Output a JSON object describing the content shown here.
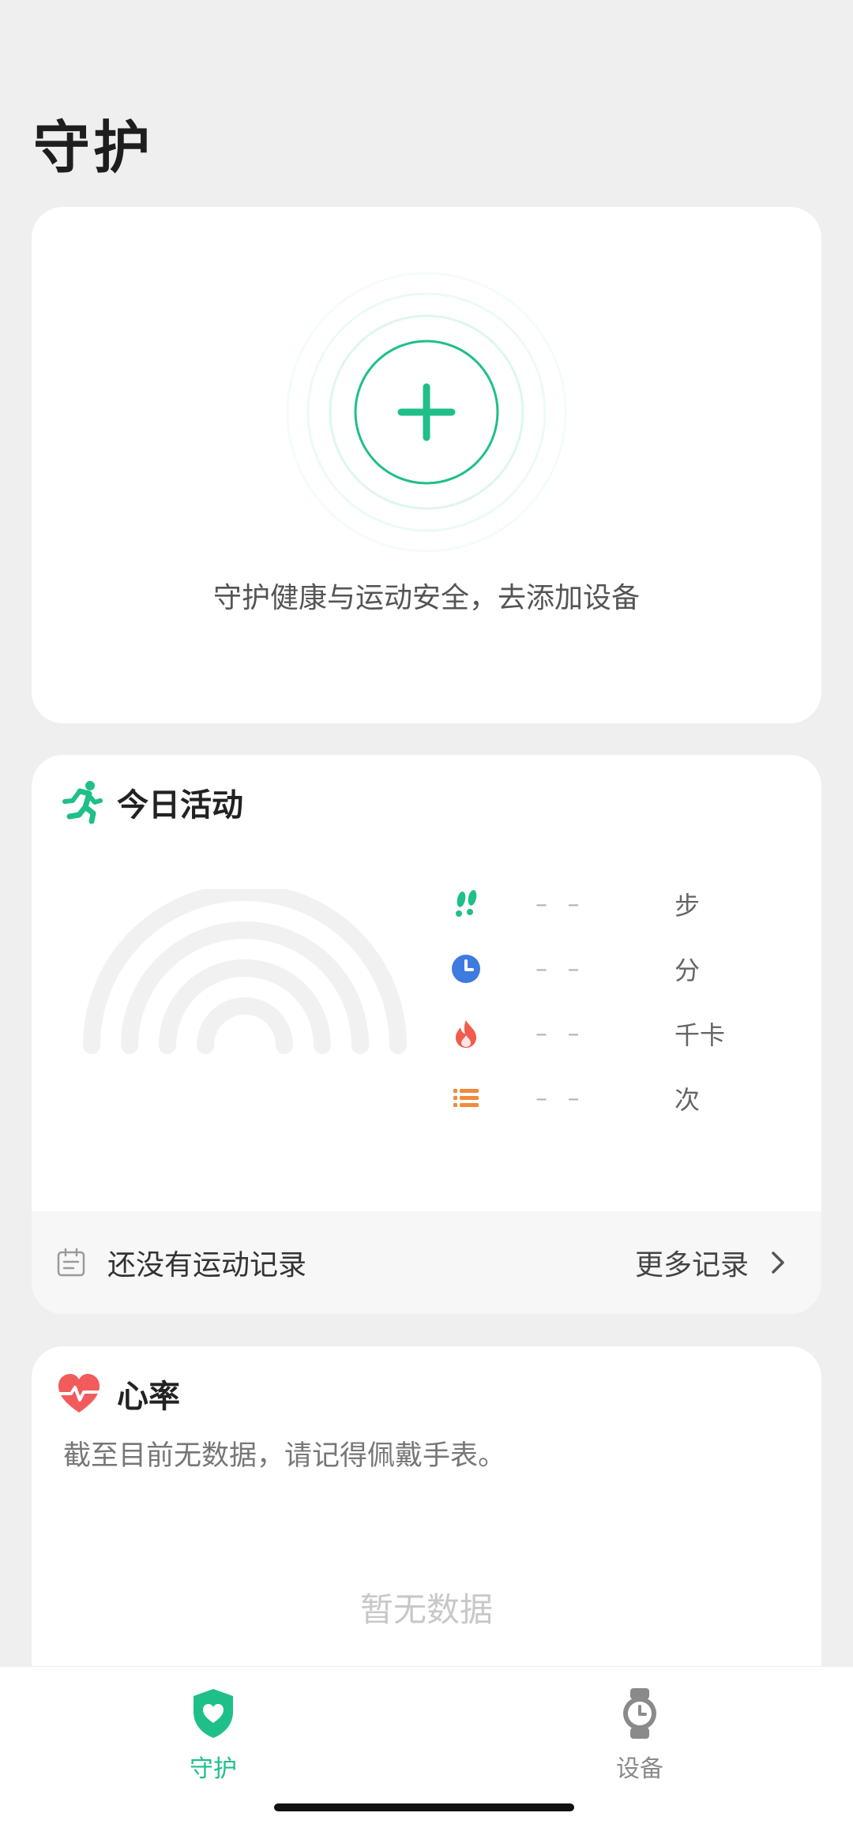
{
  "page": {
    "title": "守护"
  },
  "add_device": {
    "prompt": "守护健康与运动安全，去添加设备"
  },
  "activity": {
    "title": "今日活动",
    "stats": [
      {
        "icon": "footsteps-icon",
        "value": "– –",
        "unit": "步"
      },
      {
        "icon": "clock-icon",
        "value": "– –",
        "unit": "分"
      },
      {
        "icon": "flame-icon",
        "value": "– –",
        "unit": "千卡"
      },
      {
        "icon": "list-icon",
        "value": "– –",
        "unit": "次"
      }
    ],
    "record_text": "还没有运动记录",
    "more_records": "更多记录"
  },
  "heart_rate": {
    "title": "心率",
    "description": "截至目前无数据，请记得佩戴手表。",
    "empty": "暂无数据"
  },
  "nav": [
    {
      "label": "守护",
      "icon": "shield-heart-icon",
      "active": true
    },
    {
      "label": "设备",
      "icon": "watch-icon",
      "active": false
    }
  ],
  "colors": {
    "accent": "#1fbf8a",
    "heart": "#f25b5b",
    "clock": "#3d7be0",
    "flame": "#f25b4e",
    "list": "#f08a3c",
    "background": "#efefef"
  }
}
